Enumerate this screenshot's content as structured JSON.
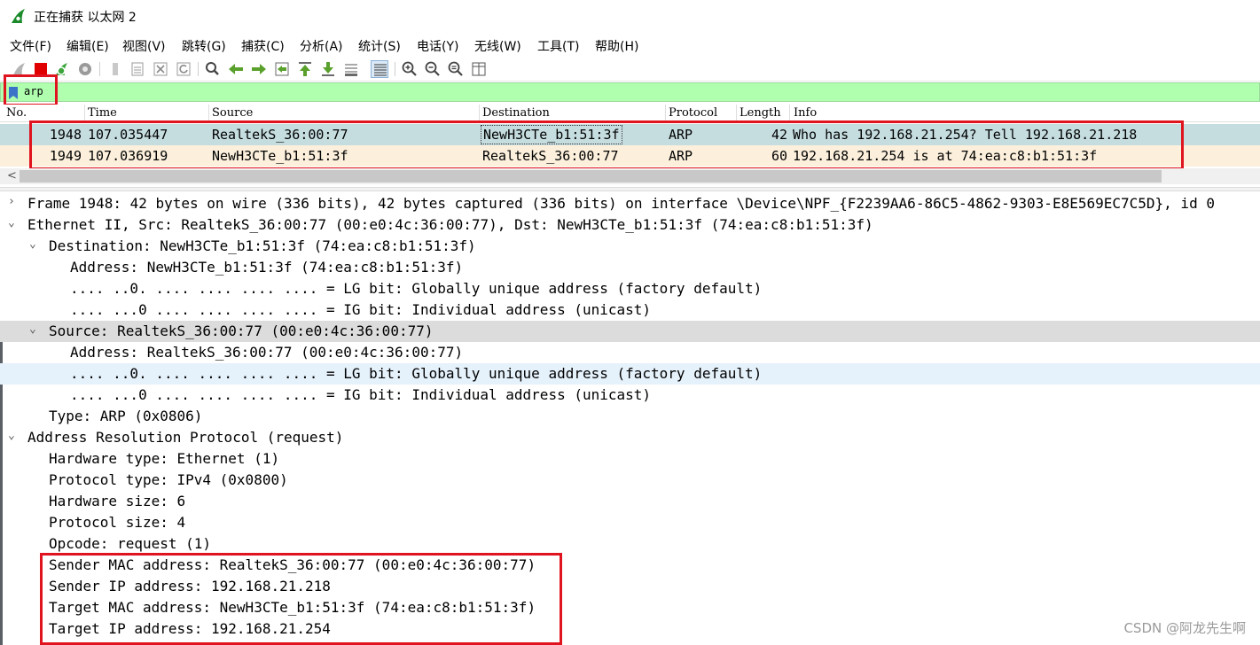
{
  "window": {
    "title": "正在捕获 以太网 2",
    "icon": "wireshark-shark-fin-icon"
  },
  "menu": [
    "文件(F)",
    "编辑(E)",
    "视图(V)",
    "跳转(G)",
    "捕获(C)",
    "分析(A)",
    "统计(S)",
    "电话(Y)",
    "无线(W)",
    "工具(T)",
    "帮助(H)"
  ],
  "toolbar": {
    "icons": [
      "start-capture-icon",
      "stop-capture-icon",
      "restart-capture-icon",
      "capture-options-icon",
      "open-file-icon",
      "save-file-icon",
      "close-file-icon",
      "reload-file-icon",
      "find-packet-icon",
      "go-back-icon",
      "go-forward-icon",
      "go-to-packet-icon",
      "go-first-packet-icon",
      "go-last-packet-icon",
      "auto-scroll-icon",
      "colorize-icon",
      "zoom-in-icon",
      "zoom-out-icon",
      "normal-size-icon",
      "resize-columns-icon"
    ]
  },
  "filter": {
    "value": "arp"
  },
  "columns": {
    "no": "No.",
    "time": "Time",
    "source": "Source",
    "destination": "Destination",
    "protocol": "Protocol",
    "length": "Length",
    "info": "Info"
  },
  "packets": [
    {
      "no": "1948",
      "time": "107.035447",
      "source": "RealtekS_36:00:77",
      "destination": "NewH3CTe_b1:51:3f",
      "protocol": "ARP",
      "length": "42",
      "info": "Who has 192.168.21.254? Tell 192.168.21.218",
      "selected": true
    },
    {
      "no": "1949",
      "time": "107.036919",
      "source": "NewH3CTe_b1:51:3f",
      "destination": "RealtekS_36:00:77",
      "protocol": "ARP",
      "length": "60",
      "info": "192.168.21.254 is at 74:ea:c8:b1:51:3f",
      "selected": false
    }
  ],
  "details": [
    {
      "text": "Frame 1948: 42 bytes on wire (336 bits), 42 bytes captured (336 bits) on interface \\Device\\NPF_{F2239AA6-86C5-4862-9303-E8E569EC7C5D}, id 0",
      "caret": ">"
    },
    {
      "text": "Ethernet II, Src: RealtekS_36:00:77 (00:e0:4c:36:00:77), Dst: NewH3CTe_b1:51:3f (74:ea:c8:b1:51:3f)",
      "caret": "v"
    },
    {
      "text": "Destination: NewH3CTe_b1:51:3f (74:ea:c8:b1:51:3f)",
      "caret": "v"
    },
    {
      "text": "Address: NewH3CTe_b1:51:3f (74:ea:c8:b1:51:3f)",
      "caret": ""
    },
    {
      "text": ".... ..0. .... .... .... .... = LG bit: Globally unique address (factory default)",
      "caret": ""
    },
    {
      "text": ".... ...0 .... .... .... .... = IG bit: Individual address (unicast)",
      "caret": ""
    },
    {
      "text": "Source: RealtekS_36:00:77 (00:e0:4c:36:00:77)",
      "caret": "v"
    },
    {
      "text": "Address: RealtekS_36:00:77 (00:e0:4c:36:00:77)",
      "caret": ""
    },
    {
      "text": ".... ..0. .... .... .... .... = LG bit: Globally unique address (factory default)",
      "caret": ""
    },
    {
      "text": ".... ...0 .... .... .... .... = IG bit: Individual address (unicast)",
      "caret": ""
    },
    {
      "text": "Type: ARP (0x0806)",
      "caret": ""
    },
    {
      "text": "Address Resolution Protocol (request)",
      "caret": "v"
    },
    {
      "text": "Hardware type: Ethernet (1)",
      "caret": ""
    },
    {
      "text": "Protocol type: IPv4 (0x0800)",
      "caret": ""
    },
    {
      "text": "Hardware size: 6",
      "caret": ""
    },
    {
      "text": "Protocol size: 4",
      "caret": ""
    },
    {
      "text": "Opcode: request (1)",
      "caret": ""
    },
    {
      "text": "Sender MAC address: RealtekS_36:00:77 (00:e0:4c:36:00:77)",
      "caret": ""
    },
    {
      "text": "Sender IP address: 192.168.21.218",
      "caret": ""
    },
    {
      "text": "Target MAC address: NewH3CTe_b1:51:3f (74:ea:c8:b1:51:3f)",
      "caret": ""
    },
    {
      "text": "Target IP address: 192.168.21.254",
      "caret": ""
    }
  ],
  "watermark": "CSDN @阿龙先生啊",
  "colors": {
    "filter_bg": "#afffaf",
    "row_selected_bg": "#c6dde0",
    "row_arp_bg": "#fcf0dc",
    "highlight_red": "#e0141e",
    "detail_hover_bg": "#e5f1fb",
    "detail_selected_bg": "#dcdcdc"
  }
}
